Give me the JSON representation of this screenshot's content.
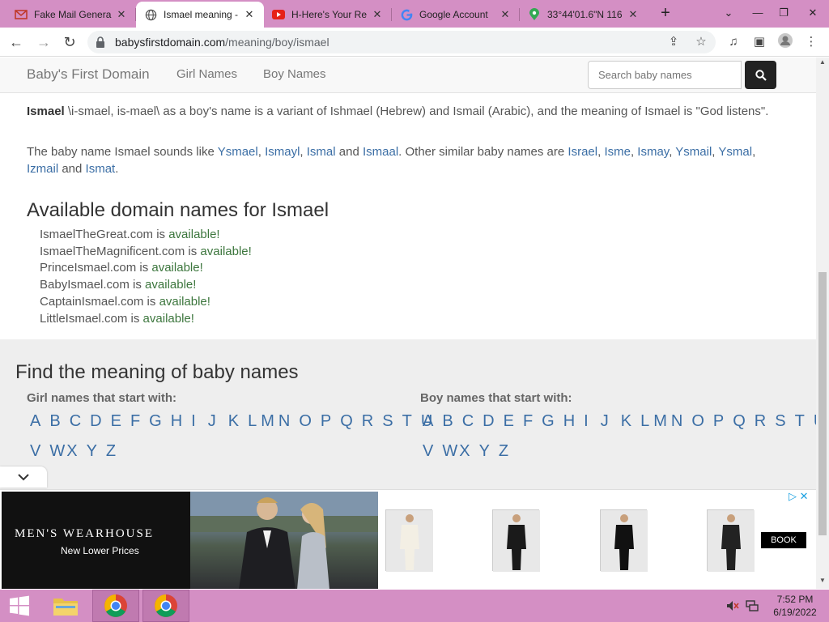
{
  "browser": {
    "tabs": [
      {
        "title": "Fake Mail Genera",
        "icon": "envelope-icon"
      },
      {
        "title": "Ismael meaning -",
        "icon": "globe-icon"
      },
      {
        "title": "H-Here's Your Re",
        "icon": "youtube-icon"
      },
      {
        "title": "Google Account",
        "icon": "google-icon"
      },
      {
        "title": "33°44'01.6\"N 116",
        "icon": "maps-icon"
      }
    ],
    "url_domain": "babysfirstdomain.com",
    "url_path": "/meaning/boy/ismael"
  },
  "navbar": {
    "brand": "Baby's First Domain",
    "links": [
      "Girl Names",
      "Boy Names"
    ],
    "search_placeholder": "Search baby names"
  },
  "meaning": {
    "name": "Ismael",
    "text": " \\i-smael, is-mael\\ as a boy's name is a variant of Ishmael (Hebrew) and Ismail (Arabic), and the meaning of Ismael is \"God listens\".",
    "sounds_like_prefix": "The baby name Ismael sounds like ",
    "sounds_like": [
      "Ysmael",
      "Ismayl",
      "Ismal",
      "Ismaal"
    ],
    "similar_prefix": ". Other similar baby names are ",
    "similar": [
      "Israel",
      "Isme",
      "Ismay",
      "Ysmail",
      "Ysmal",
      "Izmail",
      "Ismat"
    ]
  },
  "domains": {
    "heading": "Available domain names for Ismael",
    "available_label": "available!",
    "items": [
      "IsmaelTheGreat.com",
      "IsmaelTheMagnificent.com",
      "PrinceIsmael.com",
      "BabyIsmael.com",
      "CaptainIsmael.com",
      "LittleIsmael.com"
    ]
  },
  "find": {
    "heading": "Find the meaning of baby names",
    "girl_label": "Girl names that start with:",
    "boy_label": "Boy names that start with:",
    "row1": [
      "A",
      "B",
      "C",
      "D",
      "E",
      "F",
      "G",
      "H",
      "I",
      "J",
      "K",
      "L",
      "M",
      "N",
      "O",
      "P",
      "Q",
      "R",
      "S",
      "T",
      "U"
    ],
    "row2": [
      "V",
      "W",
      "X",
      "Y",
      "Z"
    ]
  },
  "ad": {
    "brand": "MEN'S WEARHOUSE",
    "tagline": "New Lower Prices",
    "cta": "BOOK"
  },
  "taskbar": {
    "time": "7:52 PM",
    "date": "6/19/2022"
  },
  "colors": {
    "chrome_pink": "#d48fc4",
    "link_blue": "#3b6ea5",
    "available_green": "#3c763d"
  }
}
